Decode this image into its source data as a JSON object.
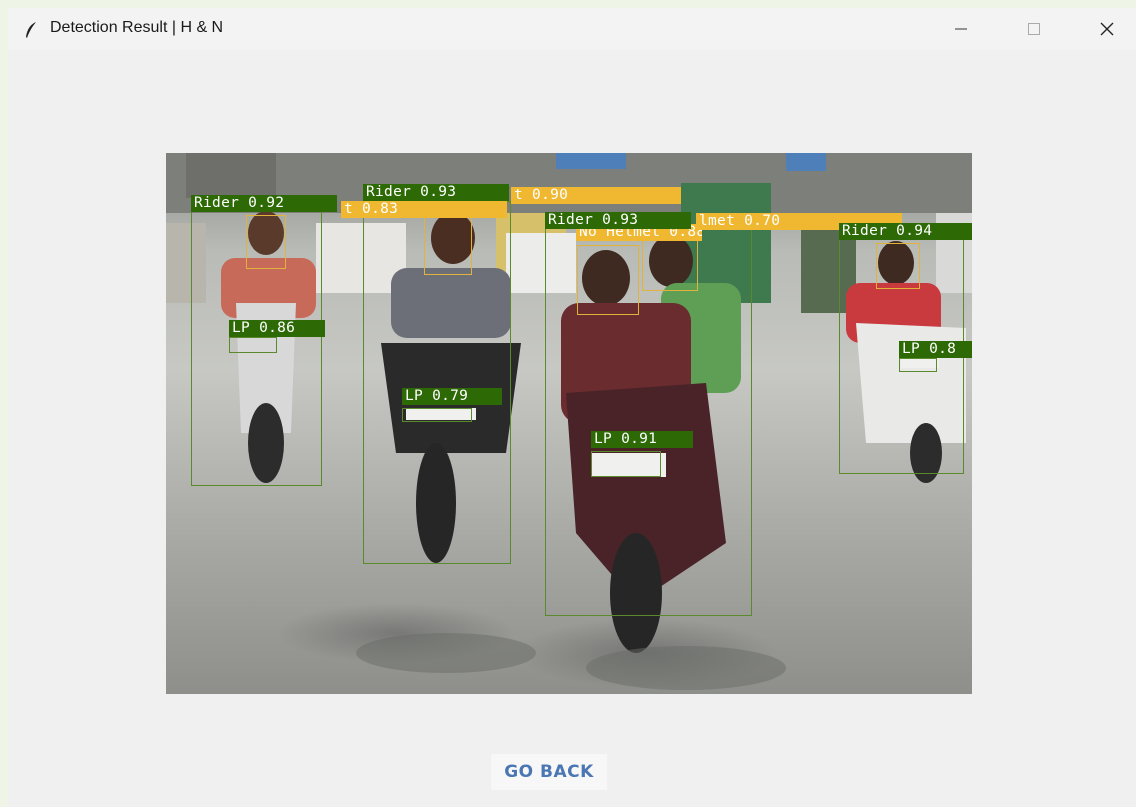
{
  "window": {
    "title": "Detection Result | H & N",
    "icon": "feather-icon",
    "controls": [
      "minimize-icon",
      "maximize-icon",
      "close-icon"
    ]
  },
  "detections": {
    "rider_1": "Rider 0.92",
    "rider_2": "Rider 0.93",
    "rider_3": "Rider 0.93",
    "rider_4": "Rider 0.94",
    "helmet_partial_1": "t 0.83",
    "helmet_partial_2": "t 0.90",
    "helmet_no": "No Helmet 0.88",
    "helmet_partial_3": "lmet 0.70",
    "plate_1": "LP 0.86",
    "plate_2": "LP 0.79",
    "plate_3": "LP 0.91",
    "plate_4": "LP 0.8"
  },
  "colors": {
    "rider_box": "#5b8a2d",
    "rider_label": "#2d6a06",
    "helmet_box": "#e2b33a",
    "helmet_label": "#f0b830",
    "button_text": "#4a77b4"
  },
  "actions": {
    "back_label": "GO BACK"
  }
}
